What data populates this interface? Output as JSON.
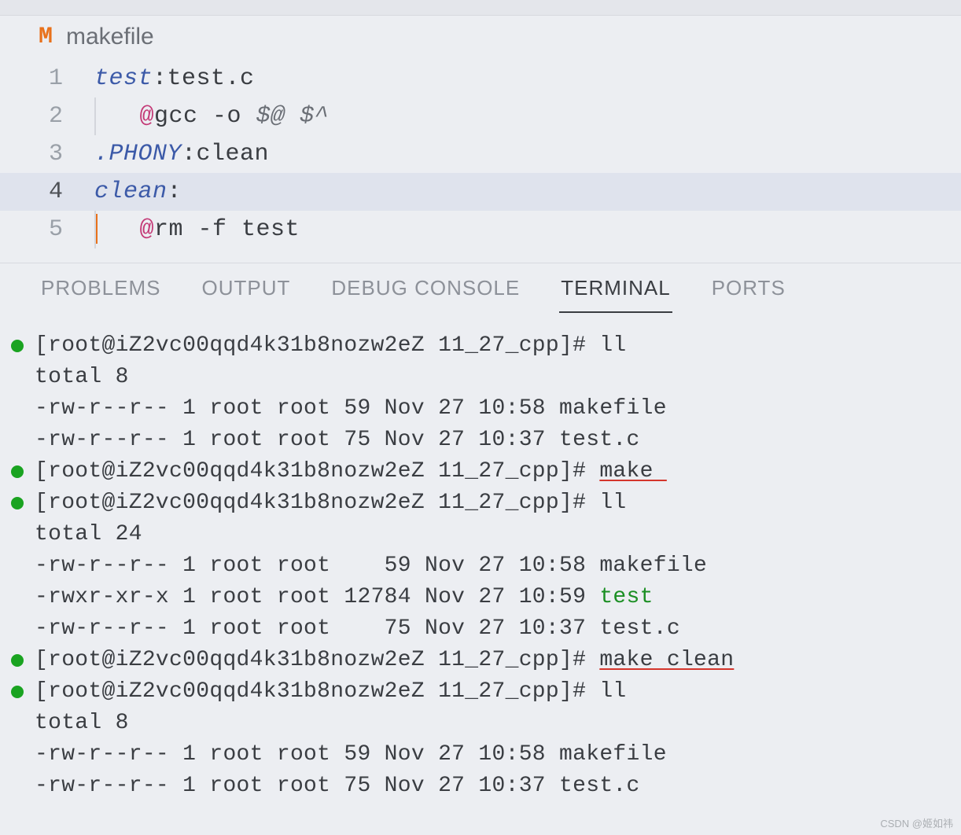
{
  "file": {
    "icon_label": "M",
    "name": "makefile"
  },
  "editor": {
    "current_line": 4,
    "lines": [
      {
        "num": "1",
        "indent_guides": 0,
        "tokens": [
          {
            "cls": "tok-target",
            "t": "test"
          },
          {
            "cls": "tok-text",
            "t": ":test.c"
          }
        ]
      },
      {
        "num": "2",
        "indent_guides": 1,
        "tokens": [
          {
            "cls": "tok-text",
            "t": "   "
          },
          {
            "cls": "tok-at",
            "t": "@"
          },
          {
            "cls": "tok-text",
            "t": "gcc -o "
          },
          {
            "cls": "tok-var",
            "t": "$@ $^"
          }
        ]
      },
      {
        "num": "3",
        "indent_guides": 0,
        "tokens": [
          {
            "cls": "tok-phony",
            "t": ".PHONY"
          },
          {
            "cls": "tok-text",
            "t": ":clean"
          }
        ]
      },
      {
        "num": "4",
        "indent_guides": 0,
        "tokens": [
          {
            "cls": "tok-target",
            "t": "clean"
          },
          {
            "cls": "tok-text",
            "t": ":"
          }
        ]
      },
      {
        "num": "5",
        "indent_guides": 1,
        "cursor_before": true,
        "tokens": [
          {
            "cls": "tok-text",
            "t": "   "
          },
          {
            "cls": "tok-at",
            "t": "@"
          },
          {
            "cls": "tok-text",
            "t": "rm -f test"
          }
        ]
      }
    ]
  },
  "panel": {
    "tabs": [
      {
        "id": "problems",
        "label": "PROBLEMS",
        "active": false
      },
      {
        "id": "output",
        "label": "OUTPUT",
        "active": false
      },
      {
        "id": "debug",
        "label": "DEBUG CONSOLE",
        "active": false
      },
      {
        "id": "terminal",
        "label": "TERMINAL",
        "active": true
      },
      {
        "id": "ports",
        "label": "PORTS",
        "active": false
      }
    ]
  },
  "terminal": {
    "prompt": "[root@iZ2vc00qqd4k31b8nozw2eZ 11_27_cpp]# ",
    "lines": [
      {
        "dot": true,
        "segs": [
          {
            "t": "[root@iZ2vc00qqd4k31b8nozw2eZ 11_27_cpp]# ll"
          }
        ]
      },
      {
        "dot": false,
        "segs": [
          {
            "t": "total 8"
          }
        ]
      },
      {
        "dot": false,
        "segs": [
          {
            "t": "-rw-r--r-- 1 root root 59 Nov 27 10:58 makefile"
          }
        ]
      },
      {
        "dot": false,
        "segs": [
          {
            "t": "-rw-r--r-- 1 root root 75 Nov 27 10:37 test.c"
          }
        ]
      },
      {
        "dot": true,
        "segs": [
          {
            "t": "[root@iZ2vc00qqd4k31b8nozw2eZ 11_27_cpp]# "
          },
          {
            "t": "make ",
            "cls": "underline-red"
          }
        ]
      },
      {
        "dot": true,
        "segs": [
          {
            "t": "[root@iZ2vc00qqd4k31b8nozw2eZ 11_27_cpp]# ll"
          }
        ]
      },
      {
        "dot": false,
        "segs": [
          {
            "t": "total 24"
          }
        ]
      },
      {
        "dot": false,
        "segs": [
          {
            "t": "-rw-r--r-- 1 root root    59 Nov 27 10:58 makefile"
          }
        ]
      },
      {
        "dot": false,
        "segs": [
          {
            "t": "-rwxr-xr-x 1 root root 12784 Nov 27 10:59 "
          },
          {
            "t": "test",
            "cls": "tt-exec"
          }
        ]
      },
      {
        "dot": false,
        "segs": [
          {
            "t": "-rw-r--r-- 1 root root    75 Nov 27 10:37 test.c"
          }
        ]
      },
      {
        "dot": true,
        "segs": [
          {
            "t": "[root@iZ2vc00qqd4k31b8nozw2eZ 11_27_cpp]# "
          },
          {
            "t": "make clean",
            "cls": "underline-red"
          }
        ]
      },
      {
        "dot": true,
        "segs": [
          {
            "t": "[root@iZ2vc00qqd4k31b8nozw2eZ 11_27_cpp]# ll"
          }
        ]
      },
      {
        "dot": false,
        "segs": [
          {
            "t": "total 8"
          }
        ]
      },
      {
        "dot": false,
        "segs": [
          {
            "t": "-rw-r--r-- 1 root root 59 Nov 27 10:58 makefile"
          }
        ]
      },
      {
        "dot": false,
        "segs": [
          {
            "t": "-rw-r--r-- 1 root root 75 Nov 27 10:37 test.c"
          }
        ]
      }
    ]
  },
  "watermark": "CSDN @姬如祎"
}
